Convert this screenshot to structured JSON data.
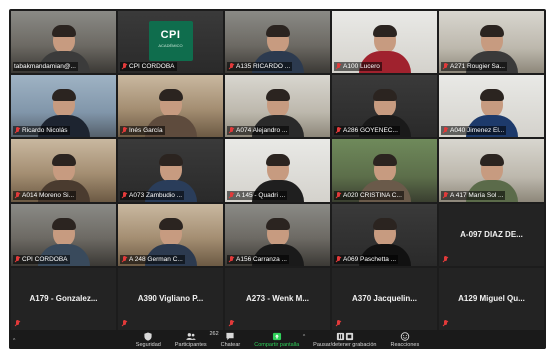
{
  "tiles": [
    {
      "name": "tabakmandamian@...",
      "kind": "video",
      "bg": "bg-room",
      "active": true,
      "muted": false,
      "shirt": "#3b3b3b"
    },
    {
      "name": "CPI CORDOBA",
      "kind": "logo",
      "bg": "bg-dark",
      "muted": true
    },
    {
      "name": "A135 RICARDO ...",
      "kind": "video",
      "bg": "bg-room",
      "muted": true,
      "shirt": "#2c3a4f"
    },
    {
      "name": "A100 Lucero",
      "kind": "video",
      "bg": "bg-white",
      "muted": true,
      "shirt": "#a0222e"
    },
    {
      "name": "A271 Rougier Sa...",
      "kind": "video",
      "bg": "bg-light",
      "muted": true,
      "shirt": "#3a3a3a"
    },
    {
      "name": "Ricardo Nicolás",
      "kind": "video",
      "bg": "bg-blue",
      "muted": true,
      "shirt": "#1d2430"
    },
    {
      "name": "Inés García",
      "kind": "video",
      "bg": "bg-warm",
      "muted": true,
      "shirt": "#5e4b3d"
    },
    {
      "name": "A074 Alejandro ...",
      "kind": "video",
      "bg": "bg-light",
      "muted": true,
      "shirt": "#2a2a2a"
    },
    {
      "name": "A286 GOYENEC...",
      "kind": "video",
      "bg": "bg-dark",
      "muted": true,
      "shirt": "#1a1a1a"
    },
    {
      "name": "A040 Jimenez El...",
      "kind": "video",
      "bg": "bg-white",
      "muted": true,
      "shirt": "#1d3a6b"
    },
    {
      "name": "A014 Moreno Si...",
      "kind": "video",
      "bg": "bg-warm",
      "muted": true,
      "shirt": "#4a3b2f"
    },
    {
      "name": "A073 Zambudio ...",
      "kind": "video",
      "bg": "bg-dark",
      "muted": true,
      "shirt": "#2a3d5a"
    },
    {
      "name": "A 145 - Quadri ...",
      "kind": "video",
      "bg": "bg-white",
      "muted": true,
      "shirt": "#1f1f1f"
    },
    {
      "name": "A020 CRISTINA C...",
      "kind": "video",
      "bg": "bg-green",
      "muted": true,
      "shirt": "#6a5a4a"
    },
    {
      "name": "A 417 María Sol ...",
      "kind": "video",
      "bg": "bg-light",
      "muted": true,
      "shirt": "#5b6b4a"
    },
    {
      "name": "CPI CORDOBA",
      "kind": "video",
      "bg": "bg-room",
      "muted": true,
      "shirt": "#394a5c"
    },
    {
      "name": "A 248 German C...",
      "kind": "video",
      "bg": "bg-warm",
      "muted": true,
      "shirt": "#2c3a4f"
    },
    {
      "name": "A156 Carranza ...",
      "kind": "video",
      "bg": "bg-room",
      "muted": true,
      "shirt": "#1a1a1a"
    },
    {
      "name": "A069 Paschetta ...",
      "kind": "video",
      "bg": "bg-dark",
      "muted": true,
      "shirt": "#111111"
    },
    {
      "name": "A-097 DIAZ DE...",
      "kind": "name",
      "muted": true
    },
    {
      "name": "A179 - Gonzalez...",
      "kind": "name",
      "muted": true
    },
    {
      "name": "A390 Vigliano P...",
      "kind": "name",
      "muted": true
    },
    {
      "name": "A273 - Wenk M...",
      "kind": "name",
      "muted": true
    },
    {
      "name": "A370 Jacquelin...",
      "kind": "name",
      "muted": true
    },
    {
      "name": "A129 Miguel Qu...",
      "kind": "name",
      "muted": true
    }
  ],
  "logo": {
    "top": "CPI",
    "sub": "ACADÉMICO"
  },
  "toolbar": {
    "security": "Seguridad",
    "participants": "Participantes",
    "participants_count": "262",
    "chat": "Chatear",
    "share": "Compartir pantalla",
    "record": "Pausar/detener grabación",
    "reactions": "Reacciones"
  },
  "colors": {
    "active_border": "#c8e03a",
    "share_green": "#2fd05a",
    "muted_red": "#e23a3a"
  }
}
